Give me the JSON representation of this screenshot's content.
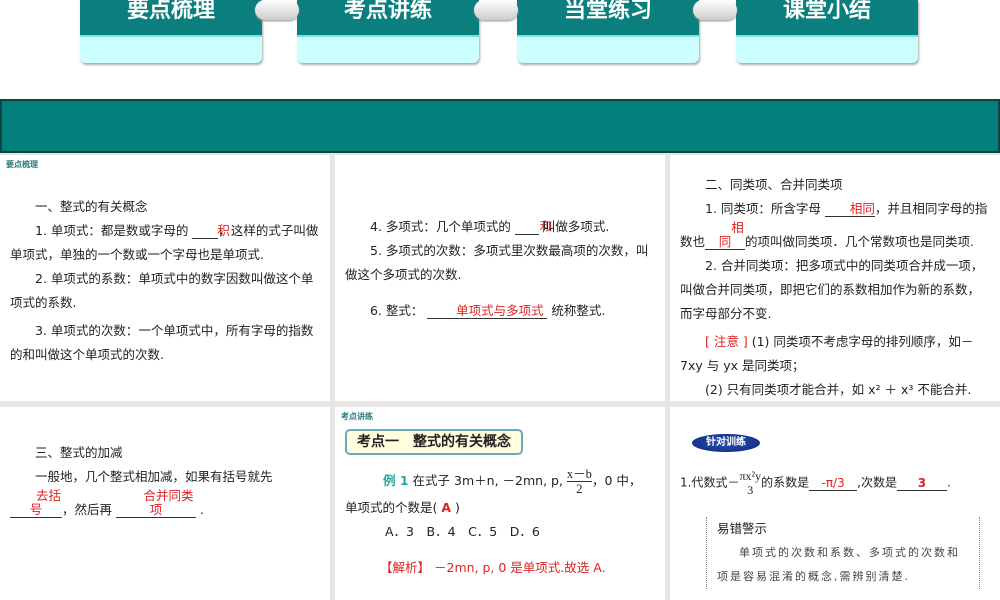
{
  "tabs": [
    "要点梳理",
    "考点讲练",
    "当堂练习",
    "课堂小结"
  ],
  "p1": {
    "label": "要点梳理",
    "heading": "一、整式的有关概念",
    "l1a": "1. 单项式：都是数或字母的",
    "b1": "积",
    "l1b": "，这样的式子叫做单项式，单独的一个数或一个字母也是单项式.",
    "l2": "2. 单项式的系数：单项式中的数字因数叫做这个单项式的系数.",
    "l3": "3. 单项式的次数：一个单项式中，所有字母的指数的和叫做这个单项式的次数."
  },
  "p2": {
    "l4a": "4. 多项式：几个单项式的",
    "b4": "和",
    "l4b": "叫做多项式.",
    "l5": "5. 多项式的次数：多项式里次数最高项的次数，叫做这个多项式的次数.",
    "l6a": "6. 整式：",
    "b6": "单项式与多项式",
    "l6b": "统称整式."
  },
  "p3": {
    "heading": "二、同类项、合并同类项",
    "l1a": "1. 同类项：所含字母",
    "b1": "相同",
    "l1b": "，并且相同字母的指数也",
    "b2": "相同",
    "l1c": "的项叫做同类项．几个常数项也是同类项.",
    "l2": "2. 合并同类项：把多项式中的同类项合并成一项，叫做合并同类项，即把它们的系数相加作为新的系数，而字母部分不变.",
    "note": "[ 注意 ]",
    "n1": "(1) 同类项不考虑字母的排列顺序，如－7xy 与 yx 是同类项；",
    "n2": "(2) 只有同类项才能合并，如 x² ＋ x³ 不能合并."
  },
  "p4": {
    "heading": "三、整式的加减",
    "l1": "一般地，几个整式相加减，如果有括号就先",
    "b1": "去括号",
    "l2": "，然后再",
    "b2": "合并同类项",
    "l3": "."
  },
  "p5": {
    "label": "考点讲练",
    "title": "考点一　整式的有关概念",
    "ex": "例 1",
    "q1": "在式子 3m＋n, －2mn, p,",
    "num": "x－b",
    "den": "2",
    "q2": "，0 中，",
    "q3": "单项式的个数是(",
    "ans": "A",
    "q4": ")",
    "opts": [
      "A．3",
      "B．4",
      "C．5",
      "D．6"
    ],
    "jx": "【解析】",
    "jxt": "－2mn, p, 0 是单项式.故选 A."
  },
  "p6": {
    "badge": "针对训练",
    "q1": "1.代数式－",
    "num": "πx²y",
    "den": "3",
    "q2": "的系数是",
    "a1": "-π/3",
    "q3": ",次数是",
    "a2": "3",
    "q4": ".",
    "warn": "易错警示",
    "wt": "单项式的次数和系数、多项式的次数和项是容易混淆的概念,需辨别清楚."
  }
}
